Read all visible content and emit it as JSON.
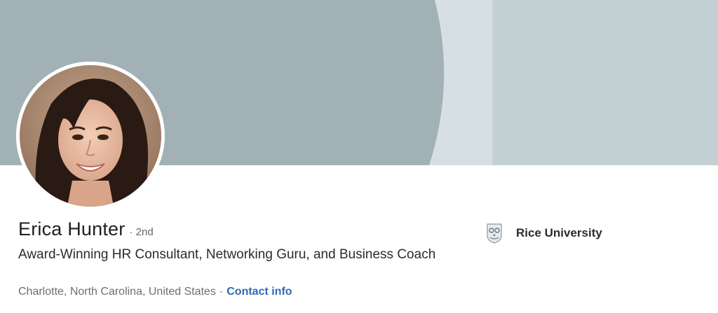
{
  "profile": {
    "name": "Erica Hunter",
    "degree": "· 2nd",
    "headline": "Award-Winning HR Consultant, Networking Guru, and Business Coach",
    "location": "Charlotte, North Carolina, United States",
    "separator": "·",
    "contact_label": "Contact info"
  },
  "education": {
    "school": "Rice University",
    "logo_icon": "owl-crest-icon"
  },
  "colors": {
    "banner_dark": "#a2b1b5",
    "banner_light": "#c3d1d5",
    "banner_pale": "#d6e0e3",
    "link": "#2d6bb8",
    "name_text": "#1f1f1f",
    "muted_text": "#6e6e6e"
  }
}
